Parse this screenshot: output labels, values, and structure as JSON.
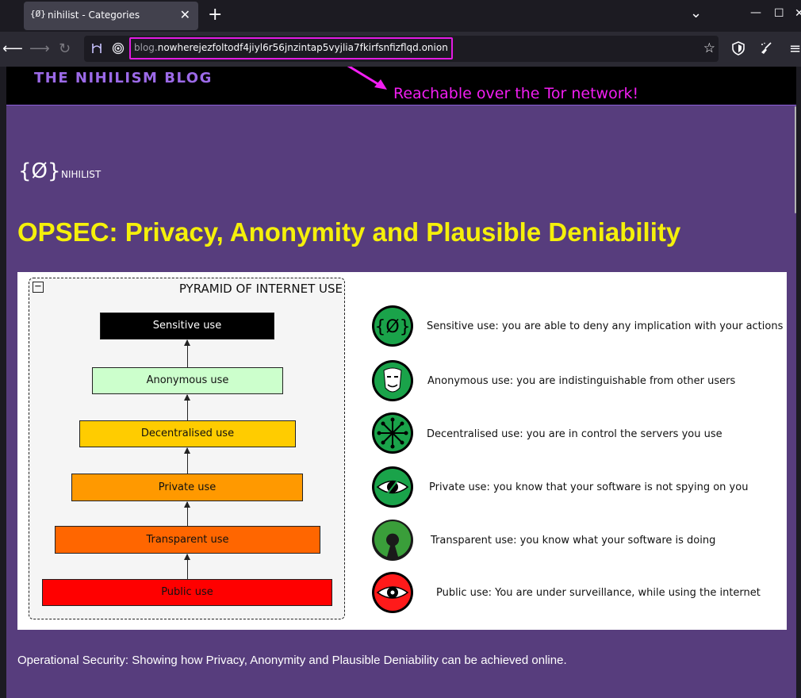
{
  "browser": {
    "tab_favicon": "{Ø}",
    "tab_title": "nihilist - Categories",
    "tab_close": "✕",
    "new_tab": "+",
    "list_all_tabs": "⌄",
    "minimize": "—",
    "maximize": "☐",
    "url_prefix": "blog.",
    "url_host": "nowherejezfoltodf4jiyl6r56jnzintap5vyjlia7fkirfsnfizflqd.onion"
  },
  "header": {
    "site_title": "THE NIHILISM BLOG",
    "annotation": "Reachable over the Tor network!"
  },
  "logo": {
    "mark": "{Ø}",
    "text": "NIHILIST"
  },
  "post": {
    "title": "OPSEC: Privacy, Anonymity and Plausible Deniability",
    "caption": "Operational Security: Showing how Privacy, Anonymity and Plausible Deniability can be achieved online."
  },
  "figure": {
    "pyramid_title": "PYRAMID OF INTERNET USE",
    "levels": [
      {
        "label": "Sensitive use",
        "color": "#000000",
        "text_color": "#ffffff"
      },
      {
        "label": "Anonymous use",
        "color": "#ccffcc",
        "text_color": "#111111"
      },
      {
        "label": "Decentralised use",
        "color": "#ffcc00",
        "text_color": "#111111"
      },
      {
        "label": "Private use",
        "color": "#ff9900",
        "text_color": "#111111"
      },
      {
        "label": "Transparent use",
        "color": "#ff6600",
        "text_color": "#111111"
      },
      {
        "label": "Public use",
        "color": "#ff0000",
        "text_color": "#111111"
      }
    ],
    "legend": [
      {
        "icon": "nihilist-logo-icon",
        "text": "Sensitive use: you are able to deny any implication with your actions"
      },
      {
        "icon": "guy-fawkes-mask-icon",
        "text": "Anonymous use: you are indistinguishable from other users"
      },
      {
        "icon": "decentralised-network-icon",
        "text": "Decentralised use: you are in control the servers you use"
      },
      {
        "icon": "eye-crossed-icon",
        "text": "Private use: you know that your software is not spying on you"
      },
      {
        "icon": "open-source-icon",
        "text": "Transparent use: you know what your software is doing"
      },
      {
        "icon": "surveillance-eye-icon",
        "text": "Public use: You are under surveillance, while using the internet"
      }
    ]
  },
  "colors": {
    "page_bg": "#573d7d",
    "title_yellow": "#f5f00a",
    "annotation_magenta": "#f21ef2",
    "site_title_purple": "#9c6ae8"
  }
}
